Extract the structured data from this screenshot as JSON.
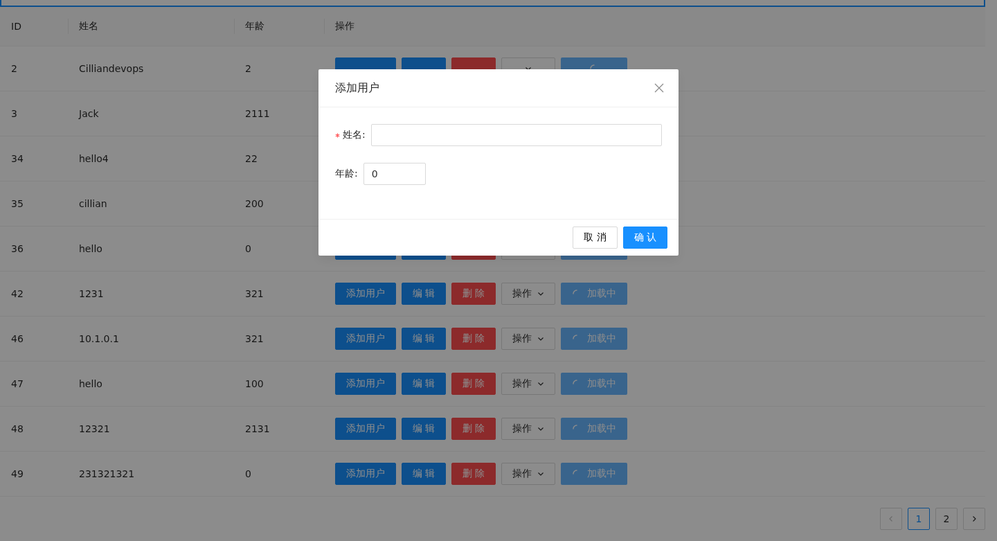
{
  "table": {
    "columns": [
      "ID",
      "姓名",
      "年龄",
      "操作"
    ],
    "rows": [
      {
        "id": "2",
        "name": "Cilliandevops",
        "age": "2",
        "actions": [
          {
            "kind": "add"
          },
          {
            "kind": "edit"
          },
          {
            "kind": "delete"
          },
          {
            "kind": "dropdown"
          },
          {
            "kind": "loading"
          }
        ]
      },
      {
        "id": "3",
        "name": "Jack",
        "age": "2111",
        "actions": []
      },
      {
        "id": "34",
        "name": "hello4",
        "age": "22",
        "actions": []
      },
      {
        "id": "35",
        "name": "cillian",
        "age": "200",
        "actions": []
      },
      {
        "id": "36",
        "name": "hello",
        "age": "0",
        "actions": [
          {
            "kind": "add"
          },
          {
            "kind": "edit"
          },
          {
            "kind": "delete"
          },
          {
            "kind": "dropdown"
          },
          {
            "kind": "loading"
          }
        ]
      },
      {
        "id": "42",
        "name": "1231",
        "age": "321",
        "actions": [
          {
            "kind": "add",
            "label": "添加用户"
          },
          {
            "kind": "edit",
            "label": "编 辑"
          },
          {
            "kind": "delete",
            "label": "删 除"
          },
          {
            "kind": "dropdown",
            "label": "操作"
          },
          {
            "kind": "loading",
            "label": "加载中"
          }
        ]
      },
      {
        "id": "46",
        "name": "10.1.0.1",
        "age": "321",
        "actions": [
          {
            "kind": "add",
            "label": "添加用户"
          },
          {
            "kind": "edit",
            "label": "编 辑"
          },
          {
            "kind": "delete",
            "label": "删 除"
          },
          {
            "kind": "dropdown",
            "label": "操作"
          },
          {
            "kind": "loading",
            "label": "加载中"
          }
        ]
      },
      {
        "id": "47",
        "name": "hello",
        "age": "100",
        "actions": [
          {
            "kind": "add",
            "label": "添加用户"
          },
          {
            "kind": "edit",
            "label": "编 辑"
          },
          {
            "kind": "delete",
            "label": "删 除"
          },
          {
            "kind": "dropdown",
            "label": "操作"
          },
          {
            "kind": "loading",
            "label": "加载中"
          }
        ]
      },
      {
        "id": "48",
        "name": "12321",
        "age": "2131",
        "actions": [
          {
            "kind": "add",
            "label": "添加用户"
          },
          {
            "kind": "edit",
            "label": "编 辑"
          },
          {
            "kind": "delete",
            "label": "删 除"
          },
          {
            "kind": "dropdown",
            "label": "操作"
          },
          {
            "kind": "loading",
            "label": "加载中"
          }
        ]
      },
      {
        "id": "49",
        "name": "231321321",
        "age": "0",
        "actions": [
          {
            "kind": "add",
            "label": "添加用户"
          },
          {
            "kind": "edit",
            "label": "编 辑"
          },
          {
            "kind": "delete",
            "label": "删 除"
          },
          {
            "kind": "dropdown",
            "label": "操作"
          },
          {
            "kind": "loading",
            "label": "加载中"
          }
        ]
      }
    ]
  },
  "pagination": {
    "prev_disabled": true,
    "pages": [
      {
        "label": "1",
        "selected": true
      },
      {
        "label": "2",
        "selected": false
      }
    ],
    "next_disabled": false
  },
  "modal": {
    "title": "添加用户",
    "fields": [
      {
        "label": "姓名:",
        "required": true,
        "kind": "text"
      },
      {
        "label": "年龄:",
        "required": false,
        "value": "0",
        "kind": "number"
      }
    ],
    "buttons": [
      {
        "kind": "default",
        "label": "取 消"
      },
      {
        "kind": "primary",
        "label": "确 认"
      }
    ]
  }
}
